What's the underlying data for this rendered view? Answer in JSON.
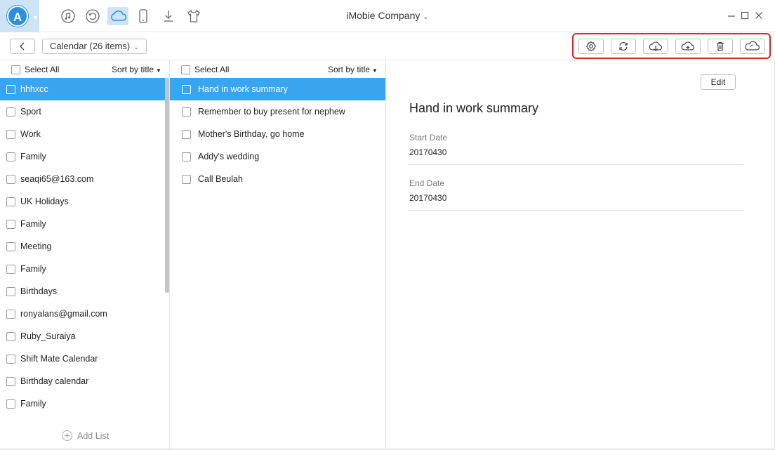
{
  "app": {
    "logo_letter": "A",
    "title": "iMobie Company"
  },
  "nav_icons": [
    "music-note-icon",
    "history-icon",
    "cloud-icon",
    "phone-icon",
    "download-icon",
    "shirt-icon"
  ],
  "toolbar": {
    "breadcrumb": "Calendar (26 items)",
    "actions": [
      "settings-icon",
      "sync-icon",
      "cloud-download-icon",
      "cloud-upload-icon",
      "trash-icon",
      "cloud-transfer-icon"
    ]
  },
  "left_panel": {
    "select_all": "Select All",
    "sort_label": "Sort by title",
    "selected_index": 0,
    "items": [
      "hhhxcc",
      "Sport",
      "Work",
      "Family",
      "seaqi65@163.com",
      "UK Holidays",
      "Family",
      "Meeting",
      "Family",
      "Birthdays",
      "ronyalans@gmail.com",
      "Ruby_Suraiya",
      "Shift Mate Calendar",
      "Birthday calendar",
      "Family"
    ],
    "add_list": "Add List"
  },
  "mid_panel": {
    "select_all": "Select All",
    "sort_label": "Sort by title",
    "selected_index": 0,
    "items": [
      "Hand in work summary",
      "Remember to buy present for nephew",
      "Mother's Birthday, go home",
      "Addy's wedding",
      "Call Beulah"
    ]
  },
  "detail": {
    "edit_label": "Edit",
    "title": "Hand in work summary",
    "start_label": "Start Date",
    "start_value": "20170430",
    "end_label": "End Date",
    "end_value": "20170430"
  },
  "colors": {
    "accent": "#3aa5ee",
    "highlight_box": "#e0202a",
    "active_nav_bg": "#cfe3f6"
  }
}
